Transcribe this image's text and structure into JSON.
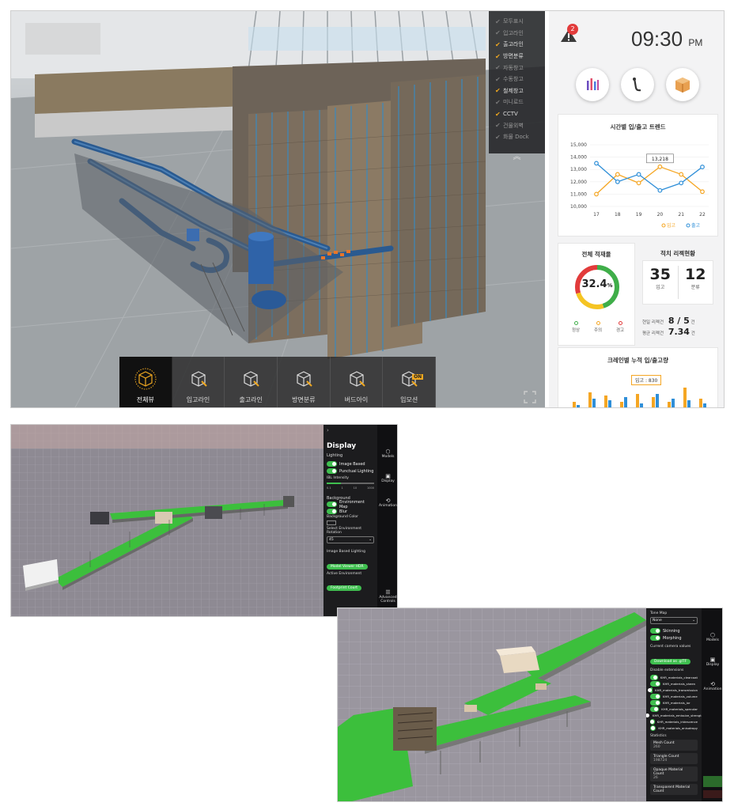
{
  "layer_menu": [
    {
      "label": "모두표시",
      "checked": false
    },
    {
      "label": "입고라인",
      "checked": false
    },
    {
      "label": "출고라인",
      "checked": true
    },
    {
      "label": "방면분류",
      "checked": true
    },
    {
      "label": "자동창고",
      "checked": false
    },
    {
      "label": "수동창고",
      "checked": false
    },
    {
      "label": "철제창고",
      "checked": true
    },
    {
      "label": "미니로드",
      "checked": false
    },
    {
      "label": "CCTV",
      "checked": true
    },
    {
      "label": "건물외벽",
      "checked": false
    },
    {
      "label": "화물 Dock",
      "checked": false
    }
  ],
  "collapse_glyph": "︽",
  "toolbar": [
    {
      "label": "전체뷰",
      "active": true,
      "icon": "globe-cube-icon"
    },
    {
      "label": "입고라인",
      "active": false,
      "icon": "cube-inbound-icon"
    },
    {
      "label": "출고라인",
      "active": false,
      "icon": "cube-outbound-icon"
    },
    {
      "label": "방면분류",
      "active": false,
      "icon": "cube-sort-icon"
    },
    {
      "label": "버드아이",
      "active": false,
      "icon": "birdeye-icon"
    },
    {
      "label": "입모션",
      "active": false,
      "icon": "hand-motion-icon",
      "badge": "ON"
    }
  ],
  "header": {
    "alarm_count": "2",
    "time": "09:30",
    "ampm": "PM"
  },
  "trend": {
    "title": "시간별 입/출고 트렌드",
    "tooltip": "13,218",
    "legend_in": "입고",
    "legend_out": "출고",
    "color_in": "#f5a623",
    "color_out": "#2f8fd8"
  },
  "chart_data": {
    "type": "line",
    "title": "시간별 입/출고 트렌드",
    "categories": [
      "17",
      "18",
      "19",
      "20",
      "21",
      "22"
    ],
    "ylim": [
      10000,
      15000
    ],
    "yticks": [
      "15,000",
      "14,000",
      "13,000",
      "12,000",
      "11,000",
      "10,000"
    ],
    "series": [
      {
        "name": "입고",
        "color": "#f5a623",
        "values": [
          11000,
          12600,
          11900,
          13218,
          12600,
          11200
        ]
      },
      {
        "name": "출고",
        "color": "#2f8fd8",
        "values": [
          13500,
          12000,
          12600,
          11300,
          11900,
          13200
        ]
      }
    ]
  },
  "load": {
    "title": "전체 적재율",
    "percent": "32.4",
    "unit": "%",
    "legend": [
      "정상",
      "주의",
      "경고"
    ],
    "legend_colors": [
      "#3fae49",
      "#f5a623",
      "#e23b3b"
    ]
  },
  "restack": {
    "title": "적치 리젝현황",
    "in_value": "35",
    "in_label": "입고",
    "sort_value": "12",
    "sort_label": "분류",
    "today_label": "현일 리젝건",
    "today_value": "8 / 5",
    "today_unit": "건",
    "avg_label": "평균 리젝건",
    "avg_value": "7.34",
    "avg_unit": "건"
  },
  "crane": {
    "title": "크레인별 누적 입/출고량",
    "tooltip": "입고 : 830"
  },
  "display_panel": {
    "title": "Display",
    "lighting": "Lighting",
    "image_based": "Image Based",
    "punctual": "Punctual Lighting",
    "ibl_intensity": "IBL Intensity",
    "ibl_ticks": [
      "0.1",
      "1",
      "10",
      "1000"
    ],
    "background": "Background",
    "env_map": "Environment Map",
    "blur": "Blur",
    "bg_color": "Background Color",
    "env_rotation": "Select Environment Rotation",
    "env_rotation_value": "45",
    "ibl_section": "Image Based Lighting",
    "btn_hdr": "Model Viewer HDR",
    "active_env": "Active Environment",
    "btn_env": "Footprint Court",
    "nav": [
      {
        "label": "Models",
        "icon": "models-icon"
      },
      {
        "label": "Display",
        "icon": "display-icon"
      },
      {
        "label": "Animation",
        "icon": "animation-icon"
      }
    ],
    "advanced": "Advanced Controls"
  },
  "ext_panel": {
    "tone_map": "Tone Map",
    "tone_value": "None",
    "skinning": "Skinning",
    "morphing": "Morphing",
    "camera_label": "Current camera values",
    "camera_btn": "Download as .glTF",
    "disable_ext": "Disable extensions",
    "extensions": [
      "KHR_materials_clearcoat",
      "KHR_materials_sheen",
      "KHR_materials_transmission",
      "KHR_materials_volume",
      "KHR_materials_ior",
      "KHR_materials_specular",
      "KHR_materials_emissive_strength",
      "KHR_materials_iridescence",
      "KHR_materials_anisotropy"
    ],
    "statistics": "Statistics",
    "stats": [
      {
        "label": "Mesh Count",
        "value": "260"
      },
      {
        "label": "Triangle Count",
        "value": "198724"
      },
      {
        "label": "Opaque Material Count",
        "value": "26"
      },
      {
        "label": "Transparent Material Count",
        "value": ""
      }
    ],
    "nav": [
      {
        "label": "Models",
        "icon": "models-icon"
      },
      {
        "label": "Display",
        "icon": "display-icon"
      },
      {
        "label": "Animation",
        "icon": "animation-icon"
      }
    ]
  }
}
